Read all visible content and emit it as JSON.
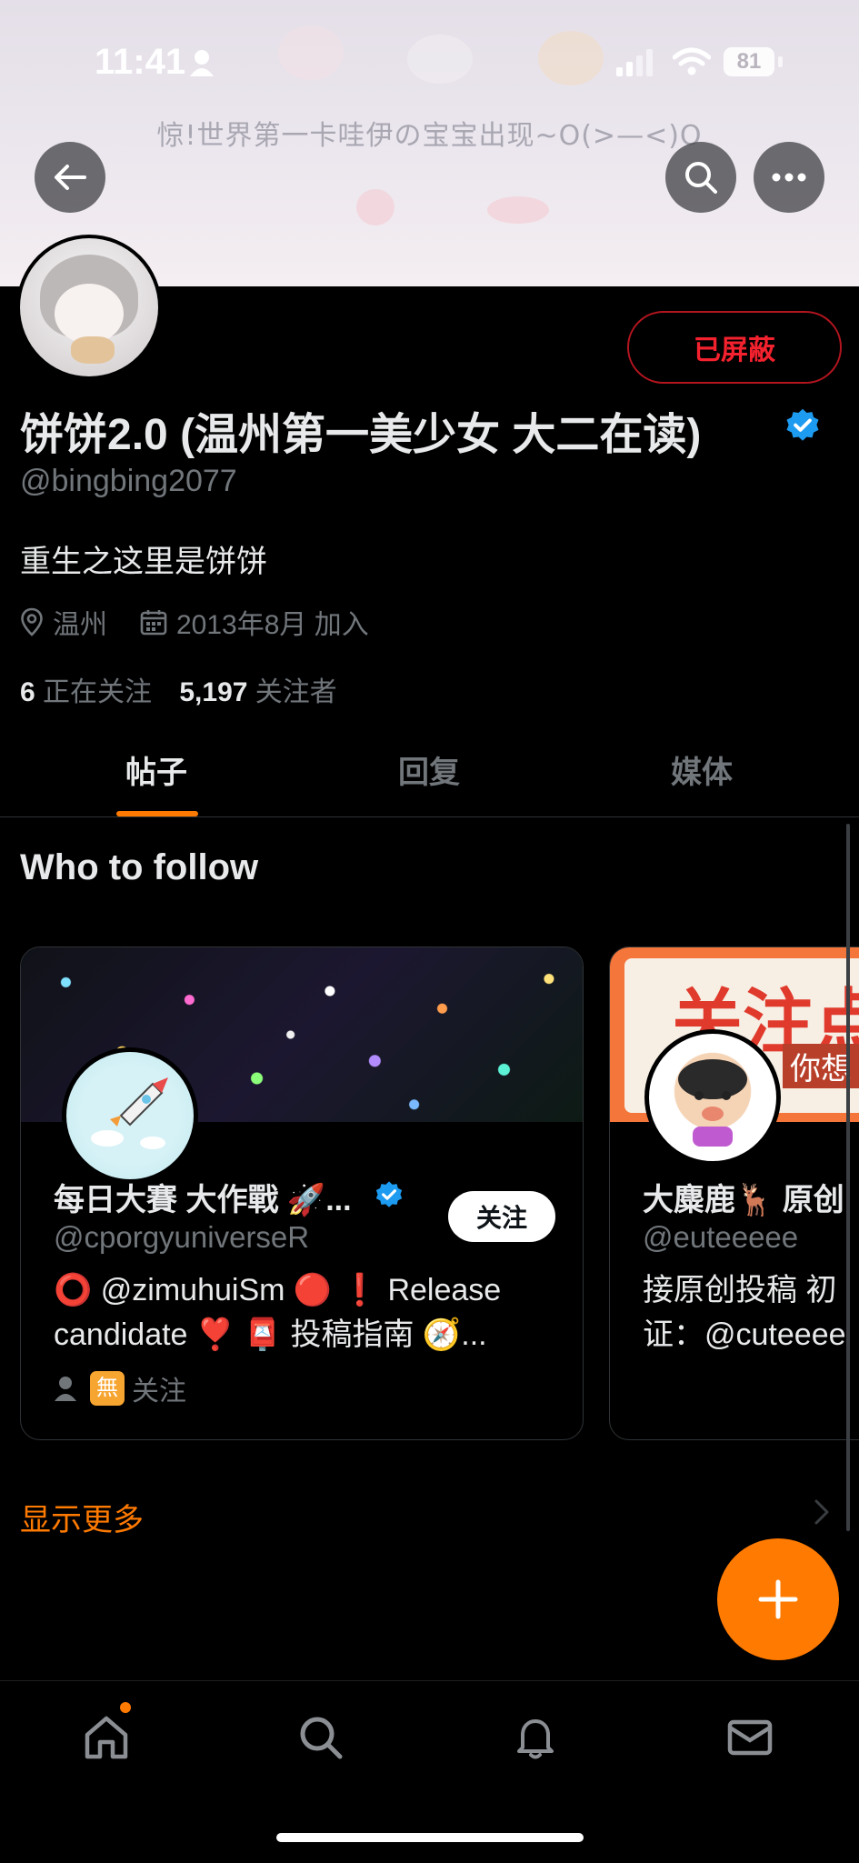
{
  "status_bar": {
    "time": "11:41",
    "battery": "81"
  },
  "banner": {
    "text": "惊!世界第一卡哇伊の宝宝出现~O(>—<)O"
  },
  "profile": {
    "blocked_label": "已屏蔽",
    "display_name": "饼饼2.0 (温州第一美少女 大二在读)",
    "handle": "@bingbing2077",
    "bio": "重生之这里是饼饼",
    "location": "温州",
    "joined": "2013年8月 加入",
    "following_count": "6",
    "following_label": "正在关注",
    "followers_count": "5,197",
    "followers_label": "关注者"
  },
  "tabs": [
    {
      "label": "帖子",
      "active": true
    },
    {
      "label": "回复",
      "active": false
    },
    {
      "label": "媒体",
      "active": false
    }
  ],
  "who_to_follow": {
    "title": "Who to follow",
    "follow_label": "关注",
    "cards": [
      {
        "name": "每日大賽 大作戰 🚀...",
        "handle": "@cporgyuniverseR",
        "bio_line1": "⭕ @zimuhuiSm 🔴 ❗ Release",
        "bio_line2": "candidate ❣️ 📮 投稿指南 🧭...",
        "footer": "关注",
        "footer_badge": "無"
      },
      {
        "name": "大麋鹿🦌 原创",
        "handle": "@euteeeee",
        "bio_line1": "接原创投稿 初",
        "bio_line2": "证：@cuteeee",
        "banner_text": "关注点",
        "banner_subtext": "你想"
      }
    ],
    "show_more": "显示更多"
  },
  "colors": {
    "accent": "#ff7a00",
    "blocked": "#f4212e",
    "verified": "#1d9bf0"
  },
  "icons": [
    "back-arrow-icon",
    "search-icon",
    "more-icon",
    "verified-badge-icon",
    "location-icon",
    "calendar-icon",
    "chevron-right-icon",
    "plus-icon",
    "home-icon",
    "bell-icon",
    "mail-icon"
  ]
}
